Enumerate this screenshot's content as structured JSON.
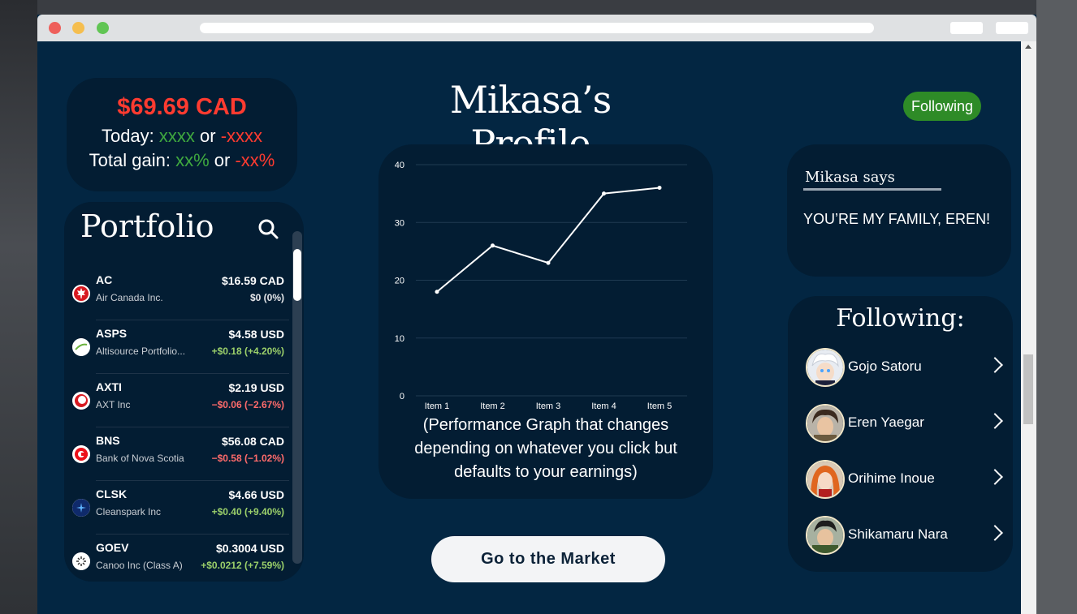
{
  "balance": {
    "amount": "$69.69 CAD",
    "today_label": "Today:",
    "today_up": "xxxx",
    "today_or": "or",
    "today_down": "-xxxx",
    "total_label": "Total gain:",
    "total_up": "xx%",
    "total_or": "or",
    "total_down": "-xx%"
  },
  "profile": {
    "title": "Mikasa’s Profile",
    "follow_label": "Following"
  },
  "portfolio": {
    "title": "Portfolio",
    "stocks": [
      {
        "symbol": "AC",
        "name": "Air Canada Inc.",
        "price": "$16.59 CAD",
        "change": "$0 (0%)",
        "trend": "neutral"
      },
      {
        "symbol": "ASPS",
        "name": "Altisource Portfolio...",
        "price": "$4.58 USD",
        "change": "+$0.18 (+4.20%)",
        "trend": "pos"
      },
      {
        "symbol": "AXTI",
        "name": "AXT Inc",
        "price": "$2.19 USD",
        "change": "−$0.06 (−2.67%)",
        "trend": "neg"
      },
      {
        "symbol": "BNS",
        "name": "Bank of Nova Scotia",
        "price": "$56.08 CAD",
        "change": "−$0.58 (−1.02%)",
        "trend": "neg"
      },
      {
        "symbol": "CLSK",
        "name": "Cleanspark Inc",
        "price": "$4.66 USD",
        "change": "+$0.40 (+9.40%)",
        "trend": "pos"
      },
      {
        "symbol": "GOEV",
        "name": "Canoo Inc (Class A)",
        "price": "$0.3004 USD",
        "change": "+$0.0212 (+7.59%)",
        "trend": "pos"
      }
    ]
  },
  "chart_data": {
    "type": "line",
    "categories": [
      "Item 1",
      "Item 2",
      "Item 3",
      "Item 4",
      "Item 5"
    ],
    "series": [
      {
        "values": [
          18,
          26,
          23,
          35,
          36
        ]
      }
    ],
    "yticks": [
      "0",
      "10",
      "20",
      "30",
      "40"
    ],
    "ylim": [
      0,
      40
    ],
    "grid": true,
    "title": "",
    "xlabel": "",
    "ylabel": ""
  },
  "chart_caption": "(Performance Graph that changes depending on whatever you click but defaults to your earnings)",
  "market_button": "Go to the Market",
  "says": {
    "header": "Mikasa says",
    "quote": "YOU’RE MY FAMILY, EREN!"
  },
  "following": {
    "title": "Following:",
    "people": [
      {
        "name": "Gojo Satoru"
      },
      {
        "name": "Eren Yaegar"
      },
      {
        "name": "Orihime Inoue"
      },
      {
        "name": "Shikamaru Nara"
      }
    ]
  },
  "colors": {
    "background": "#032642",
    "card": "#031d33",
    "accent_red": "#ff3b30",
    "accent_green": "#3fa83f",
    "follow_green": "#2e8b27"
  }
}
